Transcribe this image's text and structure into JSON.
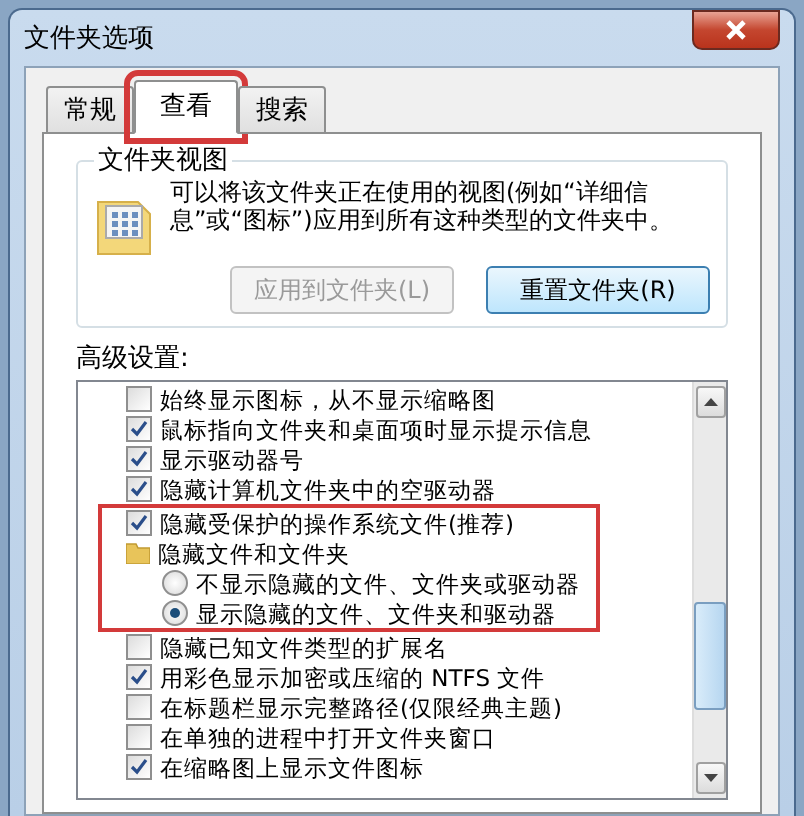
{
  "window": {
    "title": "文件夹选项"
  },
  "tabs": [
    {
      "label": "常规",
      "selected": false,
      "highlighted": false
    },
    {
      "label": "查看",
      "selected": true,
      "highlighted": true
    },
    {
      "label": "搜索",
      "selected": false,
      "highlighted": false
    }
  ],
  "folder_views": {
    "title": "文件夹视图",
    "description": "可以将该文件夹正在使用的视图(例如“详细信息”或“图标”)应用到所有这种类型的文件夹中。",
    "buttons": [
      {
        "label": "应用到文件夹(L)",
        "disabled": true
      },
      {
        "label": "重置文件夹(R)",
        "disabled": false
      }
    ]
  },
  "advanced": {
    "label": "高级设置:",
    "items": [
      {
        "kind": "checkbox",
        "label": "始终显示图标，从不显示缩略图",
        "checked": false,
        "highlighted": false
      },
      {
        "kind": "checkbox",
        "label": "鼠标指向文件夹和桌面项时显示提示信息",
        "checked": true,
        "highlighted": false
      },
      {
        "kind": "checkbox",
        "label": "显示驱动器号",
        "checked": true,
        "highlighted": false
      },
      {
        "kind": "checkbox",
        "label": "隐藏计算机文件夹中的空驱动器",
        "checked": true,
        "highlighted": false
      },
      {
        "kind": "checkbox",
        "label": "隐藏受保护的操作系统文件(推荐)",
        "checked": true,
        "highlighted": true
      },
      {
        "kind": "folder",
        "label": "隐藏文件和文件夹",
        "highlighted": true
      },
      {
        "kind": "radio",
        "label": "不显示隐藏的文件、文件夹或驱动器",
        "selected": false,
        "highlighted": true
      },
      {
        "kind": "radio",
        "label": "显示隐藏的文件、文件夹和驱动器",
        "selected": true,
        "highlighted": true
      },
      {
        "kind": "checkbox",
        "label": "隐藏已知文件类型的扩展名",
        "checked": false,
        "highlighted": false
      },
      {
        "kind": "checkbox",
        "label": "用彩色显示加密或压缩的 NTFS 文件",
        "checked": true,
        "highlighted": false
      },
      {
        "kind": "checkbox",
        "label": "在标题栏显示完整路径(仅限经典主题)",
        "checked": false,
        "highlighted": false
      },
      {
        "kind": "checkbox",
        "label": "在单独的进程中打开文件夹窗口",
        "checked": false,
        "highlighted": false
      },
      {
        "kind": "checkbox",
        "label": "在缩略图上显示文件图标",
        "checked": true,
        "highlighted": false
      }
    ]
  }
}
